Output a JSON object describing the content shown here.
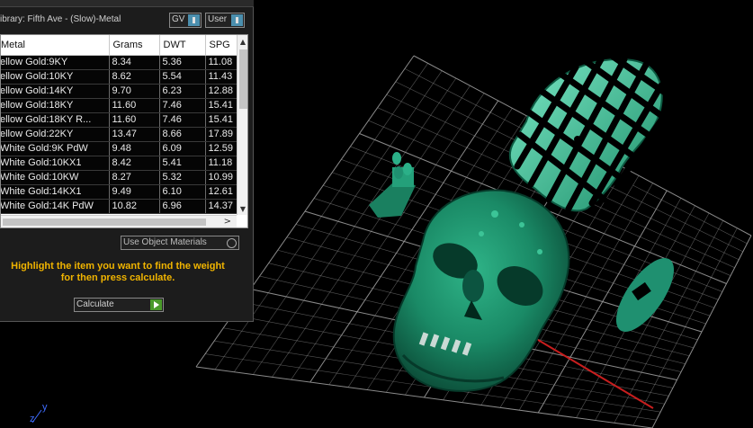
{
  "panel": {
    "library_title": "ibrary: Fifth Ave - (Slow)-Metal",
    "gv_label": "GV",
    "user_label": "User",
    "table": {
      "columns": [
        "Metal",
        "Grams",
        "DWT",
        "SPG"
      ],
      "rows": [
        [
          "ellow Gold:9KY",
          "8.34",
          "5.36",
          "11.08"
        ],
        [
          "ellow Gold:10KY",
          "8.62",
          "5.54",
          "11.43"
        ],
        [
          "ellow Gold:14KY",
          "9.70",
          "6.23",
          "12.88"
        ],
        [
          "ellow Gold:18KY",
          "11.60",
          "7.46",
          "15.41"
        ],
        [
          "ellow Gold:18KY R...",
          "11.60",
          "7.46",
          "15.41"
        ],
        [
          "ellow Gold:22KY",
          "13.47",
          "8.66",
          "17.89"
        ],
        [
          "White Gold:9K PdW",
          "9.48",
          "6.09",
          "12.59"
        ],
        [
          "White Gold:10KX1",
          "8.42",
          "5.41",
          "11.18"
        ],
        [
          "White Gold:10KW",
          "8.27",
          "5.32",
          "10.99"
        ],
        [
          "White Gold:14KX1",
          "9.49",
          "6.10",
          "12.61"
        ],
        [
          "White Gold:14K PdW",
          "10.82",
          "6.96",
          "14.37"
        ]
      ]
    },
    "use_object_materials": "Use Object Materials",
    "hint_line1": "Highlight the item you want to find the weight",
    "hint_line2": "for then press calculate.",
    "calculate_label": "Calculate"
  },
  "viewport": {
    "axis_y": "y",
    "axis_z": "z",
    "model_color": "#1f8f6a",
    "grid_color": "#9a9a9a",
    "x_axis_color": "#c81e1e"
  }
}
